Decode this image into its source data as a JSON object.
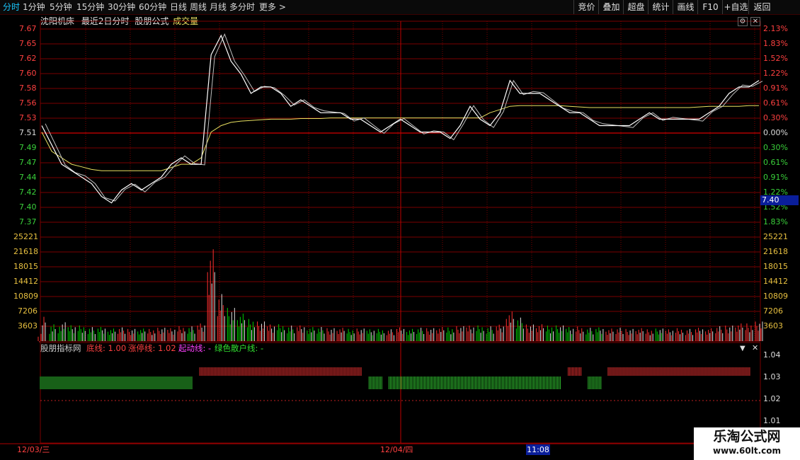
{
  "toolbar": {
    "periods": [
      "分时",
      "1分钟",
      "5分钟",
      "15分钟",
      "30分钟",
      "60分钟",
      "日线",
      "周线",
      "月线",
      "多分时",
      "更多 >"
    ],
    "active_period": "分时",
    "right_buttons": [
      "竞价",
      "叠加",
      "超盘",
      "统计",
      "画线",
      "F10",
      "+自选",
      "返回"
    ]
  },
  "header": {
    "stock_name": "沈阳机床",
    "range": "最近2日分时",
    "formula": "股朋公式",
    "volume_label": "成交量"
  },
  "price_axis": {
    "left": [
      "7.67",
      "7.65",
      "7.62",
      "7.60",
      "7.58",
      "7.56",
      "7.53",
      "7.51",
      "7.49",
      "7.47",
      "7.44",
      "7.42",
      "7.40",
      "7.37"
    ],
    "right": [
      "2.13%",
      "1.83%",
      "1.52%",
      "1.22%",
      "0.91%",
      "0.61%",
      "0.30%",
      "0.00%",
      "0.30%",
      "0.61%",
      "0.91%",
      "1.22%",
      "1.52%",
      "1.83%"
    ]
  },
  "volume_axis": [
    "25221",
    "21618",
    "18015",
    "14412",
    "10809",
    "7206",
    "3603"
  ],
  "indicator": {
    "name": "股朋指标网",
    "bottom_line": "底线: 1.00",
    "limit_up_line": "涨停线: 1.02",
    "start_line": "起动线: -",
    "green_line": "绿色散户线: -",
    "axis": [
      "1.04",
      "1.03",
      "1.02",
      "1.01"
    ]
  },
  "time_axis": {
    "day1": "12/03/三",
    "day2": "12/04/四",
    "cursor_time": "11:08"
  },
  "cursor_price": "7.40",
  "watermark": {
    "title": "乐淘公式网",
    "url": "www.60lt.com"
  },
  "colors": {
    "up": "#ff3030",
    "down": "#00d000",
    "price_line": "#ffffff",
    "avg_line": "#e8e060",
    "grid": "#7a0000",
    "axis_text_red": "#ff4040",
    "axis_text_green": "#3ad03a"
  },
  "chart_data": {
    "type": "line",
    "series": [
      {
        "name": "price",
        "values": [
          7.52,
          7.49,
          7.46,
          7.45,
          7.44,
          7.43,
          7.41,
          7.4,
          7.42,
          7.43,
          7.42,
          7.43,
          7.44,
          7.46,
          7.47,
          7.46,
          7.46,
          7.63,
          7.66,
          7.62,
          7.6,
          7.57,
          7.58,
          7.58,
          7.57,
          7.55,
          7.56,
          7.55,
          7.54,
          7.54,
          7.54,
          7.53,
          7.53,
          7.52,
          7.51,
          7.52,
          7.53,
          7.52,
          7.51,
          7.51,
          7.51,
          7.5,
          7.52,
          7.55,
          7.53,
          7.52,
          7.54,
          7.59,
          7.57,
          7.57,
          7.57,
          7.56,
          7.55,
          7.54,
          7.54,
          7.53,
          7.52,
          7.52,
          7.52,
          7.52,
          7.53,
          7.54,
          7.53,
          7.53,
          7.53,
          7.53,
          7.53,
          7.54,
          7.55,
          7.57,
          7.58,
          7.58,
          7.59
        ]
      },
      {
        "name": "average",
        "values": [
          7.51,
          7.48,
          7.47,
          7.46,
          7.456,
          7.452,
          7.45,
          7.45,
          7.45,
          7.45,
          7.45,
          7.45,
          7.45,
          7.455,
          7.46,
          7.46,
          7.47,
          7.51,
          7.52,
          7.525,
          7.527,
          7.528,
          7.529,
          7.53,
          7.53,
          7.53,
          7.531,
          7.531,
          7.531,
          7.532,
          7.532,
          7.532,
          7.532,
          7.532,
          7.532,
          7.532,
          7.532,
          7.532,
          7.532,
          7.532,
          7.532,
          7.532,
          7.532,
          7.532,
          7.532,
          7.54,
          7.545,
          7.55,
          7.551,
          7.551,
          7.551,
          7.551,
          7.551,
          7.55,
          7.549,
          7.548,
          7.548,
          7.548,
          7.548,
          7.548,
          7.548,
          7.548,
          7.548,
          7.548,
          7.548,
          7.548,
          7.549,
          7.55,
          7.55,
          7.55,
          7.55,
          7.551,
          7.551
        ]
      }
    ],
    "volume": [
      6200,
      5200,
      4800,
      4300,
      4000,
      3800,
      3600,
      3400,
      3500,
      3300,
      3200,
      3300,
      3400,
      3500,
      3800,
      4000,
      4500,
      28000,
      12000,
      9000,
      7000,
      6000,
      5000,
      4500,
      4300,
      4200,
      4000,
      3800,
      3600,
      3500,
      3400,
      3300,
      3200,
      3200,
      3100,
      3200,
      3500,
      3300,
      3400,
      3500,
      3600,
      3700,
      3800,
      4200,
      4000,
      4000,
      4200,
      8000,
      6000,
      4500,
      4300,
      4200,
      4000,
      3800,
      3700,
      3600,
      3500,
      3400,
      3400,
      3300,
      3300,
      3200,
      3200,
      3200,
      3300,
      3300,
      3400,
      3500,
      3800,
      4200,
      4500,
      4800,
      5000
    ],
    "indicator_bands": [
      {
        "from": 0,
        "to": 15,
        "color": "green"
      },
      {
        "from": 16,
        "to": 32,
        "color": "red"
      },
      {
        "from": 33,
        "to": 34,
        "color": "green"
      },
      {
        "from": 35,
        "to": 52,
        "color": "green"
      },
      {
        "from": 53,
        "to": 54,
        "color": "red"
      },
      {
        "from": 55,
        "to": 56,
        "color": "green"
      },
      {
        "from": 57,
        "to": 71,
        "color": "red"
      }
    ],
    "ylim": [
      7.37,
      7.67
    ],
    "base_price": 7.51,
    "x_labels": [
      "12/03/三",
      "12/04/四"
    ]
  }
}
